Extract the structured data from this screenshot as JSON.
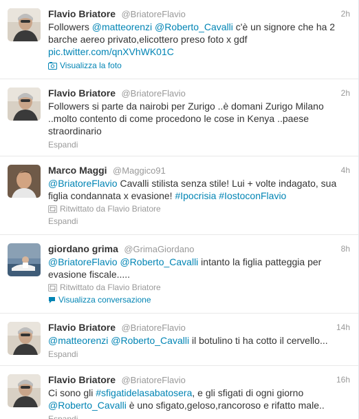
{
  "tweets": [
    {
      "fullname": "Flavio Briatore",
      "username": "@BriatoreFlavio",
      "time": "2h",
      "text_parts": [
        {
          "t": "Followers "
        },
        {
          "t": "@matteorenzi",
          "k": "mention"
        },
        {
          "t": " "
        },
        {
          "t": "@Roberto_Cavalli",
          "k": "mention"
        },
        {
          "t": " c'è un signore che ha 2 barche aereo privato,elicottero preso foto x gdf "
        },
        {
          "t": "pic.twitter.com/qnXVhWK01C",
          "k": "link"
        }
      ],
      "action": "Visualizza la foto",
      "action_icon": "photo-icon"
    },
    {
      "fullname": "Flavio Briatore",
      "username": "@BriatoreFlavio",
      "time": "2h",
      "text_parts": [
        {
          "t": "Followers si parte da nairobi  per Zurigo ..è domani Zurigo Milano ..molto contento di come procedono le cose in Kenya ..paese straordinario"
        }
      ],
      "action": "Espandi"
    },
    {
      "fullname": "Marco Maggi",
      "username": "@Maggico91",
      "time": "4h",
      "text_parts": [
        {
          "t": "@BriatoreFlavio",
          "k": "mention"
        },
        {
          "t": " Cavalli stilista senza stile! Lui + volte indagato, sua figlia condannata x evasione! "
        },
        {
          "t": "#Ipocrisia",
          "k": "hashtag"
        },
        {
          "t": " "
        },
        {
          "t": "#IostoconFlavio",
          "k": "hashtag"
        }
      ],
      "retweeted_by": "Ritwittato da Flavio Briatore",
      "action": "Espandi"
    },
    {
      "fullname": "giordano grima",
      "username": "@GrimaGiordano",
      "time": "8h",
      "text_parts": [
        {
          "t": "@BriatoreFlavio",
          "k": "mention"
        },
        {
          "t": " "
        },
        {
          "t": "@Roberto_Cavalli",
          "k": "mention"
        },
        {
          "t": " intanto la figlia patteggia per evasione fiscale....."
        }
      ],
      "retweeted_by": "Ritwittato da Flavio Briatore",
      "action": "Visualizza conversazione",
      "action_icon": "conversation-icon"
    },
    {
      "fullname": "Flavio Briatore",
      "username": "@BriatoreFlavio",
      "time": "14h",
      "text_parts": [
        {
          "t": "@matteorenzi",
          "k": "mention"
        },
        {
          "t": " "
        },
        {
          "t": "@Roberto_Cavalli",
          "k": "mention"
        },
        {
          "t": "  il botulino ti ha cotto il cervello..."
        }
      ],
      "action": "Espandi"
    },
    {
      "fullname": "Flavio Briatore",
      "username": "@BriatoreFlavio",
      "time": "16h",
      "text_parts": [
        {
          "t": "Ci sono gli "
        },
        {
          "t": "#sfigatidelasabatosera",
          "k": "hashtag"
        },
        {
          "t": ", e gli sfigati di ogni giorno "
        },
        {
          "t": "@Roberto_Cavalli",
          "k": "mention"
        },
        {
          "t": "  è uno sfigato,geloso,rancoroso e rifatto male.."
        }
      ],
      "action": "Espandi"
    }
  ],
  "colors": {
    "link": "#0084b4",
    "meta": "#999999",
    "text": "#333333"
  }
}
